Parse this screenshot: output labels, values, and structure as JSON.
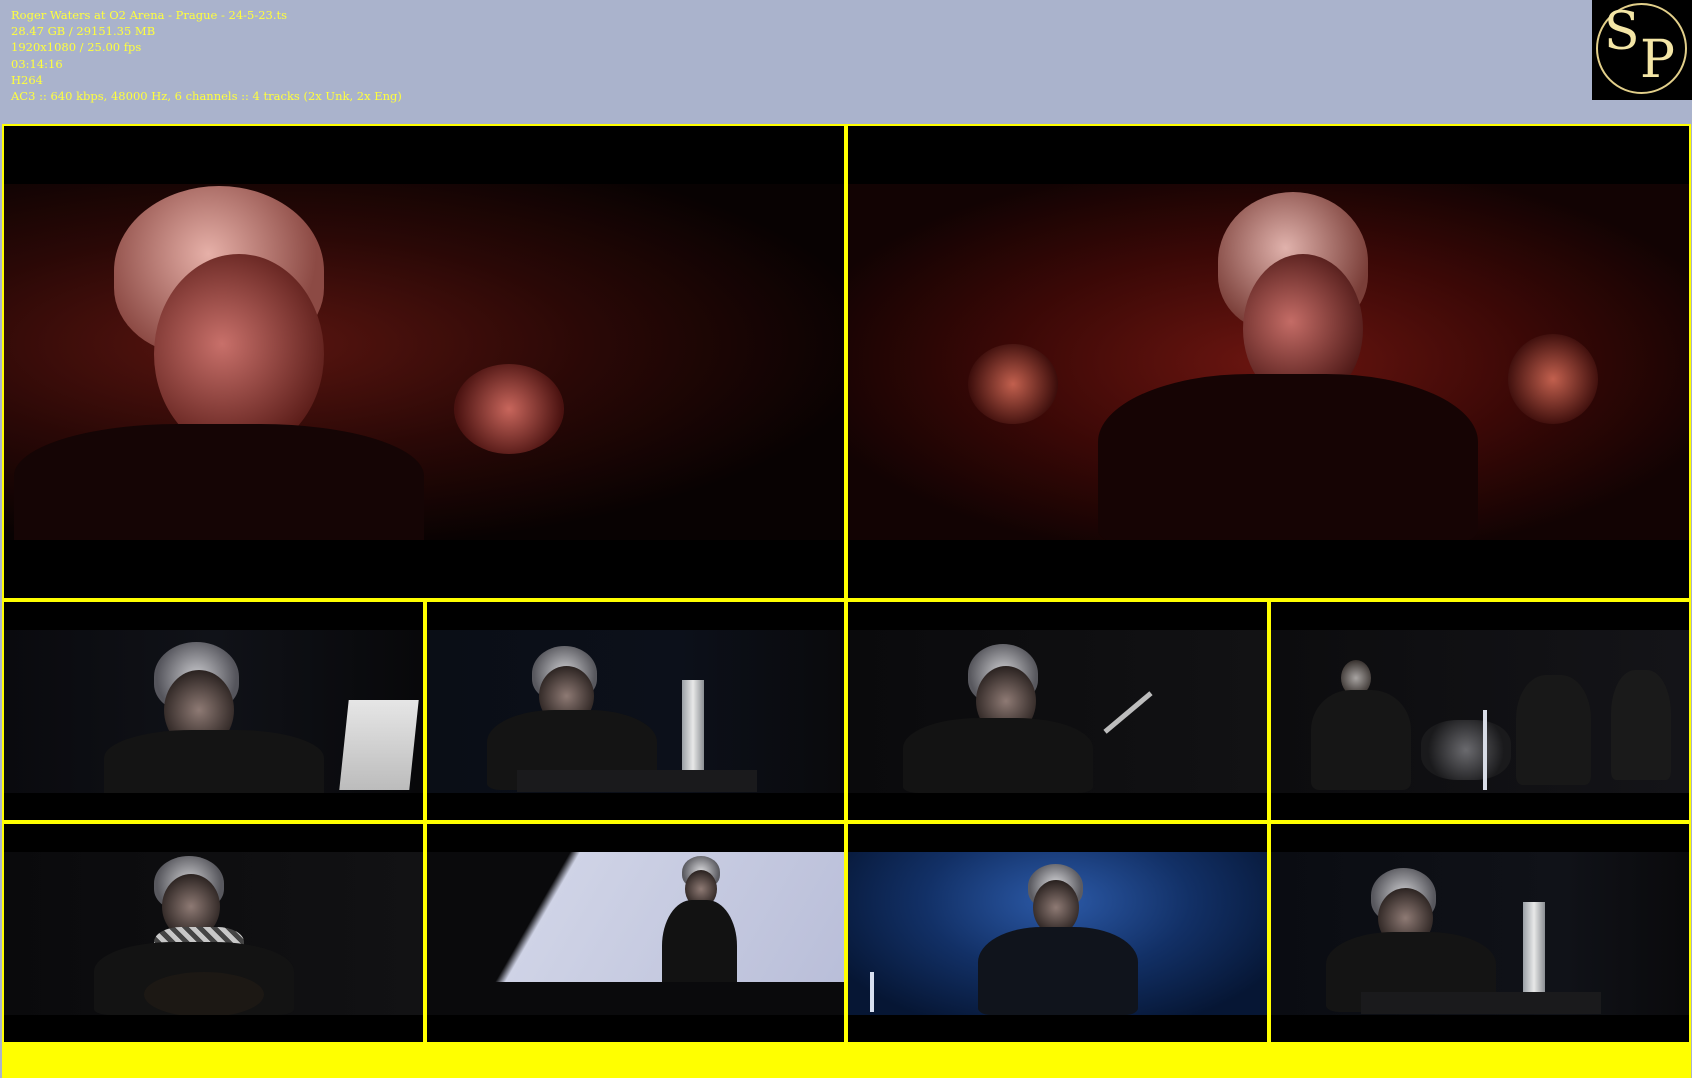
{
  "file_info": {
    "title": "Roger Waters at O2 Arena - Prague - 24-5-23.ts",
    "size": "28.47 GB / 29151.35 MB",
    "resolution": "1920x1080 / 25.00 fps",
    "duration": "03:14:16",
    "video_codec": "H264",
    "audio": "AC3 :: 640 kbps, 48000 Hz, 6 channels :: 4 tracks (2x Unk, 2x Eng)"
  },
  "logo": {
    "letter1": "S",
    "letter2": "P"
  },
  "colors": {
    "header_bg": "#aab3cc",
    "info_text": "#ffff3c",
    "grid_border": "#ffff00",
    "logo_gold": "#e2cf8a"
  },
  "thumbnails": [
    {
      "id": "thumb-1",
      "scene": "close-up singing, red stage light"
    },
    {
      "id": "thumb-2",
      "scene": "singing with raised fists, red light"
    },
    {
      "id": "thumb-3",
      "scene": "singing with lyric sheet"
    },
    {
      "id": "thumb-4",
      "scene": "seated at piano with bottle"
    },
    {
      "id": "thumb-5",
      "scene": "seated at piano singing"
    },
    {
      "id": "thumb-6",
      "scene": "band on stage with drums"
    },
    {
      "id": "thumb-7",
      "scene": "singing with acoustic guitar and scarf"
    },
    {
      "id": "thumb-8",
      "scene": "playing guitar before bright screen"
    },
    {
      "id": "thumb-9",
      "scene": "singing under blue light"
    },
    {
      "id": "thumb-10",
      "scene": "seated at piano with bottle"
    }
  ]
}
